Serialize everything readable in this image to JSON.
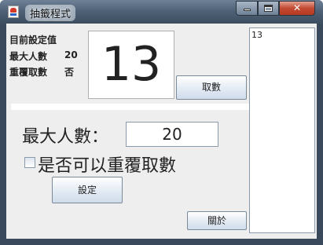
{
  "window": {
    "title": "抽籤程式"
  },
  "info": {
    "heading": "目前設定值",
    "max_people_label": "最大人數",
    "max_people_value": "20",
    "repeat_label": "重覆取數",
    "repeat_value": "否"
  },
  "display": {
    "current_number": "13"
  },
  "buttons": {
    "draw": "取數",
    "set": "設定",
    "about": "關於"
  },
  "form": {
    "max_people_label": "最大人數：",
    "max_people_value": "20",
    "repeat_checkbox_label": "是否可以重覆取數",
    "repeat_checked": false
  },
  "log": {
    "text": "13"
  },
  "colors": {
    "title_bar": "#4f6277",
    "client_bg": "#eeeeee",
    "close_button": "#c24a32"
  }
}
